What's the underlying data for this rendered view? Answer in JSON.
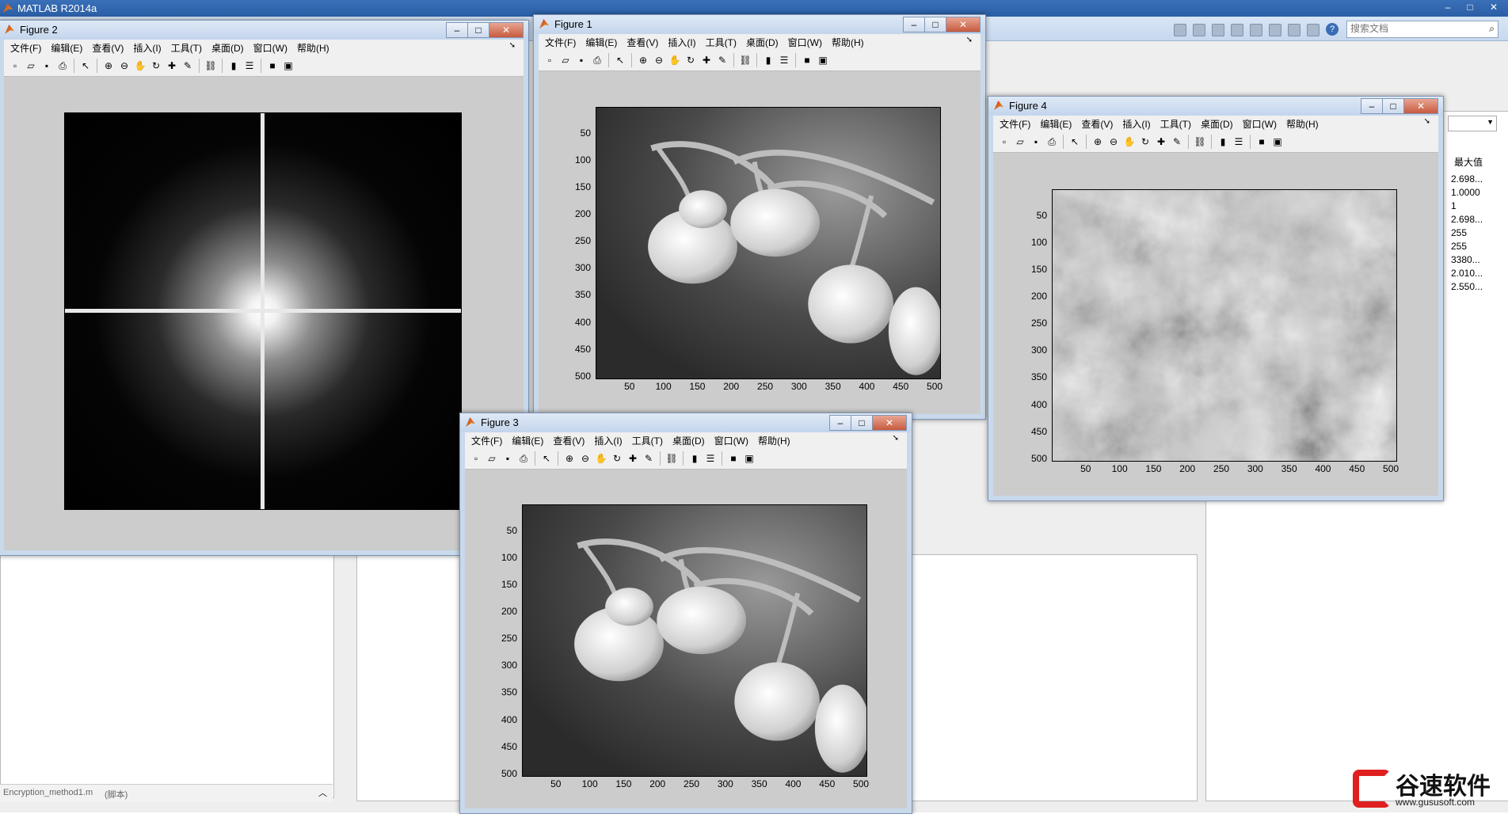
{
  "app": {
    "title": "MATLAB R2014a"
  },
  "search": {
    "placeholder": "搜索文档"
  },
  "menus": [
    "文件(F)",
    "编辑(E)",
    "查看(V)",
    "插入(I)",
    "工具(T)",
    "桌面(D)",
    "窗口(W)",
    "帮助(H)"
  ],
  "figures": {
    "f1": {
      "title": "Figure 1"
    },
    "f2": {
      "title": "Figure 2"
    },
    "f3": {
      "title": "Figure 3"
    },
    "f4": {
      "title": "Figure 4"
    }
  },
  "axis_ticks": {
    "x": [
      "50",
      "100",
      "150",
      "200",
      "250",
      "300",
      "350",
      "400",
      "450",
      "500"
    ],
    "y": [
      "50",
      "100",
      "150",
      "200",
      "250",
      "300",
      "350",
      "400",
      "450",
      "500"
    ]
  },
  "workspace": {
    "column_header": "最大值",
    "values": [
      "2.698...",
      "1.0000",
      "1",
      "2.698...",
      "255",
      "255",
      "3380...",
      "2.010...",
      "2.550..."
    ]
  },
  "current_folder": {
    "file": "Encryption_method1.m",
    "file_tag": "(脚本)"
  },
  "watermark": {
    "brand": "谷速软件",
    "url": "www.gususoft.com"
  },
  "window_controls": {
    "minimize": "–",
    "maximize": "□",
    "close": "✕"
  }
}
